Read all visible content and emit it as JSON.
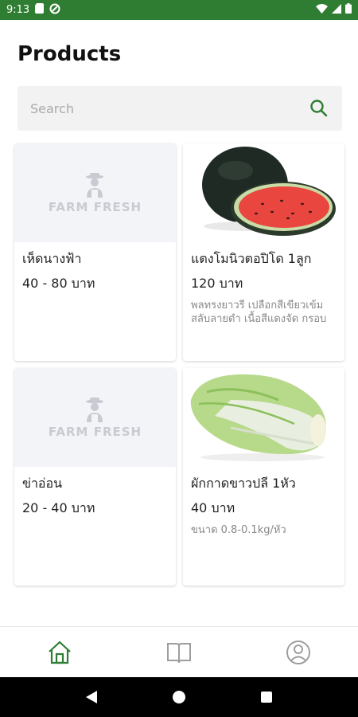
{
  "status_bar": {
    "time": "9:13",
    "background": "#2e7d32"
  },
  "header": {
    "title": "Products"
  },
  "search": {
    "placeholder": "Search",
    "icon": "search-icon",
    "icon_color": "#2e7d32"
  },
  "products": [
    {
      "name": "เห็ดนางฟ้า",
      "price": "40 - 80 บาท",
      "description": "",
      "image": "farm-fresh-placeholder",
      "logo_text": "FARM FRESH"
    },
    {
      "name": "แตงโมนิวตอปิโด 1ลูก",
      "price": "120 บาท",
      "description": "พลทรงยาวรี เปลือกสีเขียวเข้ม สลับลายดำ เนื้อสีแดงจัด กรอบ",
      "image": "watermelon-photo"
    },
    {
      "name": "ข่าอ่อน",
      "price": "20 - 40 บาท",
      "description": "",
      "image": "farm-fresh-placeholder",
      "logo_text": "FARM FRESH"
    },
    {
      "name": "ผักกาดขาวปลี 1หัว",
      "price": "40 บาท",
      "description": "ขนาด 0.8-0.1kg/หัว",
      "image": "napa-cabbage-photo"
    }
  ],
  "bottom_nav": {
    "items": [
      {
        "icon": "home-icon",
        "active": true
      },
      {
        "icon": "book-icon",
        "active": false
      },
      {
        "icon": "profile-icon",
        "active": false
      }
    ],
    "active_color": "#2e7d32",
    "inactive_color": "#9e9e9e"
  },
  "system_nav": {
    "buttons": [
      "back-icon",
      "home-circle-icon",
      "recents-icon"
    ]
  }
}
